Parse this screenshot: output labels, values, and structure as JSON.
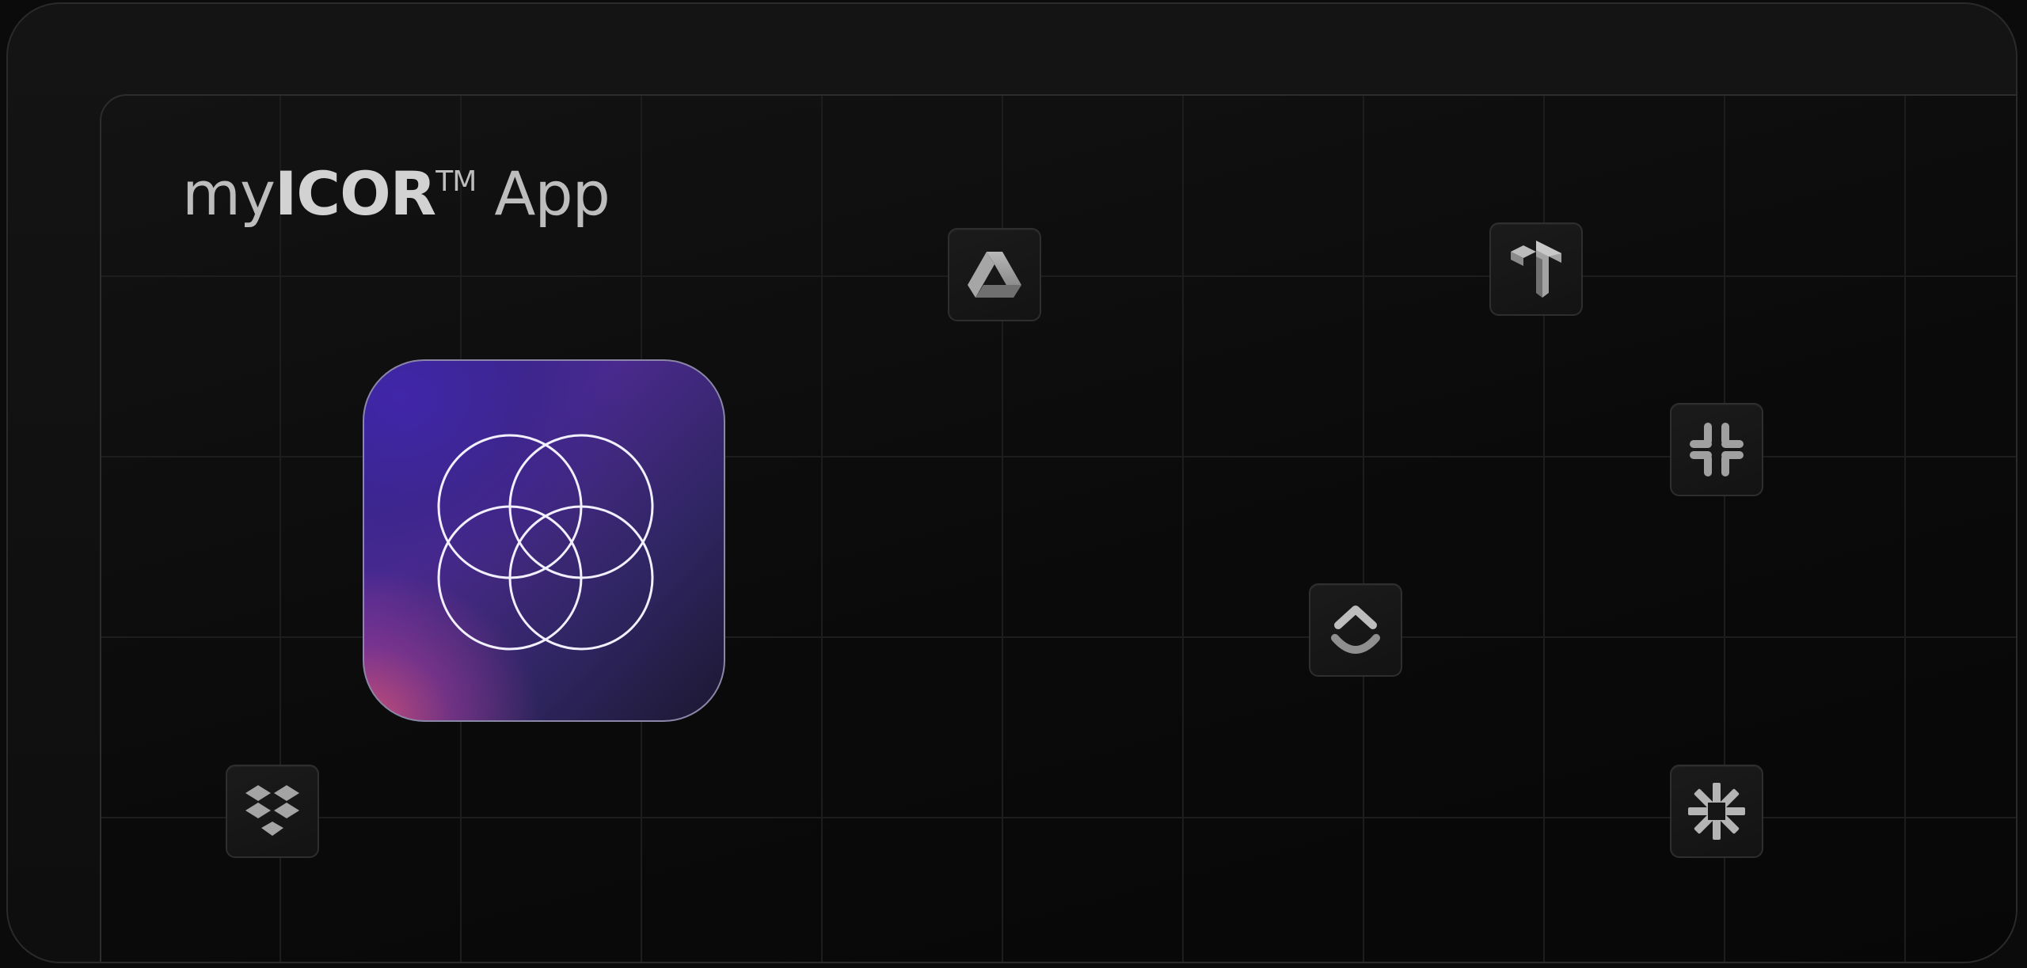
{
  "title": {
    "prefix": "my",
    "brand": "ICOR",
    "trademark": "TM",
    "suffix": " App"
  },
  "hero": {
    "icon": "four-circles-logo-icon",
    "accent_colors": [
      "#3a2a9a",
      "#cd5078",
      "#1c1830"
    ]
  },
  "integrations": [
    {
      "name": "google-drive-icon"
    },
    {
      "name": "tana-icon"
    },
    {
      "name": "slack-icon"
    },
    {
      "name": "clickup-icon"
    },
    {
      "name": "dropbox-icon"
    },
    {
      "name": "zapier-icon"
    }
  ],
  "colors": {
    "background": "#0b0b0b",
    "tile_border": "#2e2e2e",
    "icon_gray": "#9a9a9a"
  }
}
